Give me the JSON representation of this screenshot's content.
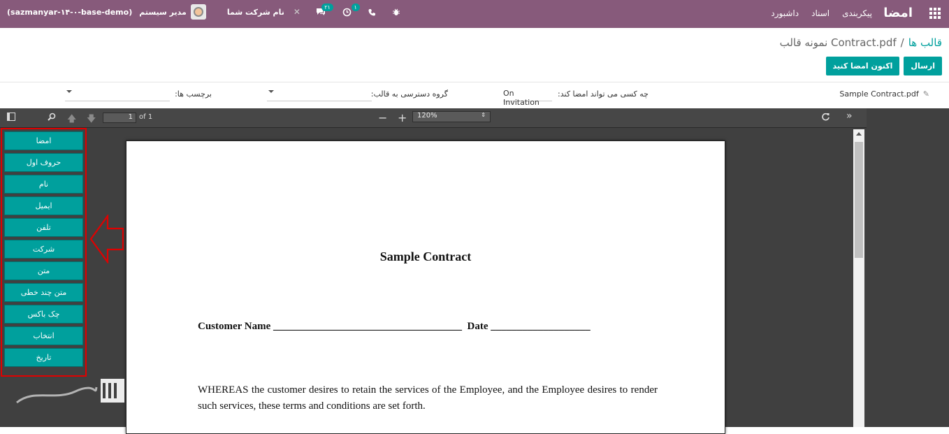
{
  "navbar": {
    "brand": "امضا",
    "menu": [
      "داشبورد",
      "اسناد",
      "پیکربندی"
    ],
    "company": "نام شرکت شما",
    "user": "مدیر سیستم",
    "database": "(sazmanyar-۱۴-۰-base-demo)",
    "activity_badge": "۱",
    "messages_badge": "۲۱"
  },
  "breadcrumb": {
    "parent": "قالب ها",
    "separator": "/",
    "current": "Contract.pdf نمونه قالب"
  },
  "actions": {
    "send": "ارسال",
    "sign_now": "اکنون امضا کنید"
  },
  "fields": {
    "filename": "Sample Contract.pdf",
    "who_can_sign_label": "چه کسی می تواند امضا کند:",
    "who_can_sign_value": "On Invitation",
    "access_group_label": "گروه دسترسی به قالب:",
    "tags_label": "برچسب ها:"
  },
  "viewer": {
    "page_number": "1",
    "page_count": "of 1",
    "zoom": "120%",
    "sign_fields": [
      "امضا",
      "حروف اول",
      "نام",
      "ایمیل",
      "تلفن",
      "شرکت",
      "متن",
      "متن چند خطی",
      "چک باکس",
      "انتخاب",
      "تاریخ"
    ]
  },
  "document": {
    "title": "Sample Contract",
    "customer_line": "Customer Name ____________________________________  Date ___________________",
    "paragraph": "WHEREAS the customer desires to retain the services of the Employee, and the Employee desires to render such services, these terms and conditions are set forth."
  }
}
